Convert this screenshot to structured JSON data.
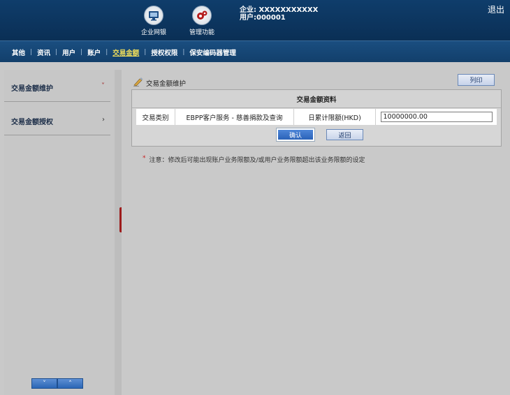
{
  "header": {
    "buttons": [
      {
        "label": "企业网银",
        "icon": "monitor-icon"
      },
      {
        "label": "管理功能",
        "icon": "gears-icon"
      }
    ],
    "company_line": "企业: XXXXXXXXXXX",
    "user_line": "用户:000001",
    "logout": "退出"
  },
  "nav": {
    "items": [
      "其他",
      "资讯",
      "用户",
      "账户",
      "交易金额",
      "授权权限",
      "保安编码器管理"
    ],
    "active": "交易金额"
  },
  "sidebar": {
    "items": [
      {
        "label": "交易金额维护",
        "chevron": "˅"
      },
      {
        "label": "交易金额授权",
        "chevron": "›"
      }
    ],
    "pager": {
      "down": "˅",
      "up": "˄"
    },
    "collapse": "‹"
  },
  "main": {
    "title": "交易金额维护",
    "print_label": "列印",
    "panel_title": "交易金额资料",
    "row": {
      "type_label": "交易类别",
      "type_value": "EBPP客户服务 - 慈善捐款及查询",
      "limit_label": "日累计限额(HKD)",
      "limit_value": "10000000.00"
    },
    "confirm_label": "确认",
    "back_label": "返回",
    "note": "注意：修改后可能出现账户业务限额及/或用户业务限额超出该业务限额的设定",
    "note_star": "*"
  },
  "colors": {
    "header_bg": "#0f3d6b",
    "nav_active": "#f3e05a",
    "collapse_tab": "#9d1b1b",
    "primary_button": "#2a62b8"
  }
}
